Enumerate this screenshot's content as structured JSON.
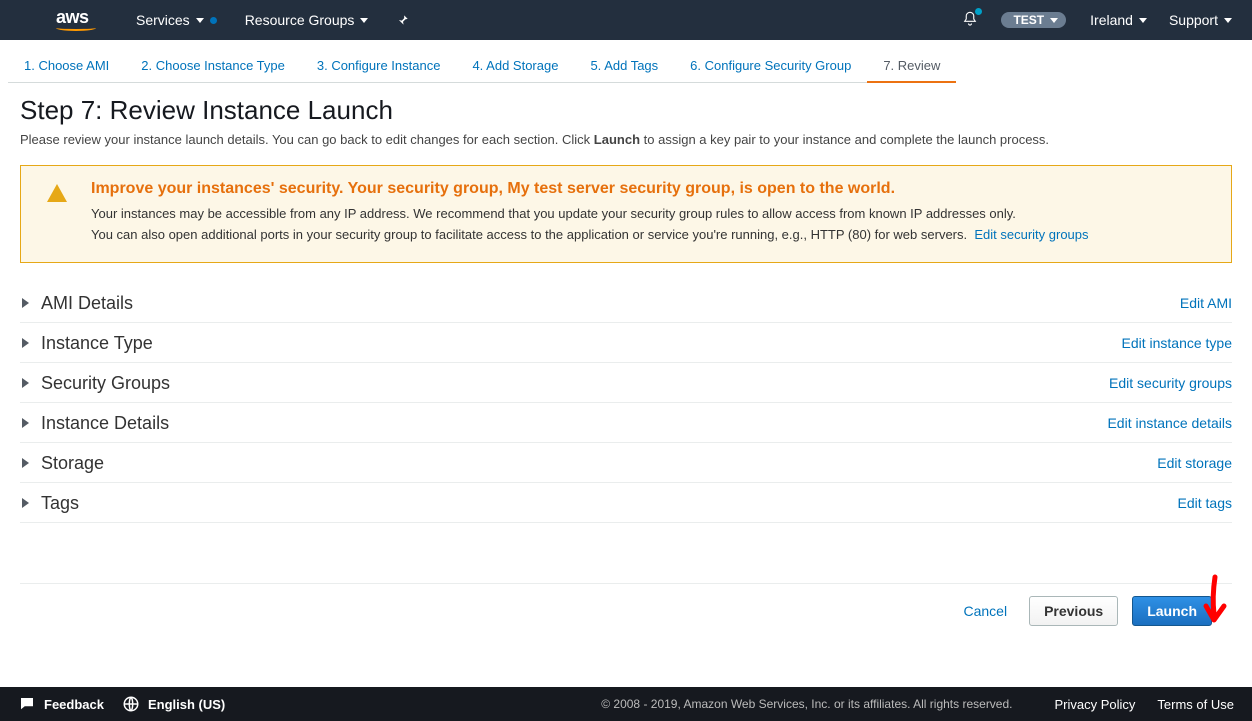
{
  "topnav": {
    "logo": "aws",
    "services": "Services",
    "resource_groups": "Resource Groups",
    "account_pill": "TEST",
    "region": "Ireland",
    "support": "Support"
  },
  "wizard": {
    "tabs": [
      "1. Choose AMI",
      "2. Choose Instance Type",
      "3. Configure Instance",
      "4. Add Storage",
      "5. Add Tags",
      "6. Configure Security Group",
      "7. Review"
    ],
    "active_index": 6
  },
  "page": {
    "title": "Step 7: Review Instance Launch",
    "desc_before": "Please review your instance launch details. You can go back to edit changes for each section. Click ",
    "desc_bold": "Launch",
    "desc_after": " to assign a key pair to your instance and complete the launch process."
  },
  "warning": {
    "title": "Improve your instances' security. Your security group, My test server security group, is open to the world.",
    "line1": "Your instances may be accessible from any IP address. We recommend that you update your security group rules to allow access from known IP addresses only.",
    "line2": "You can also open additional ports in your security group to facilitate access to the application or service you're running, e.g., HTTP (80) for web servers.",
    "link": "Edit security groups"
  },
  "sections": [
    {
      "title": "AMI Details",
      "edit": "Edit AMI"
    },
    {
      "title": "Instance Type",
      "edit": "Edit instance type"
    },
    {
      "title": "Security Groups",
      "edit": "Edit security groups"
    },
    {
      "title": "Instance Details",
      "edit": "Edit instance details"
    },
    {
      "title": "Storage",
      "edit": "Edit storage"
    },
    {
      "title": "Tags",
      "edit": "Edit tags"
    }
  ],
  "footer": {
    "cancel": "Cancel",
    "previous": "Previous",
    "launch": "Launch"
  },
  "bottom": {
    "feedback": "Feedback",
    "language": "English (US)",
    "copyright": "© 2008 - 2019, Amazon Web Services, Inc. or its affiliates. All rights reserved.",
    "privacy": "Privacy Policy",
    "terms": "Terms of Use"
  }
}
